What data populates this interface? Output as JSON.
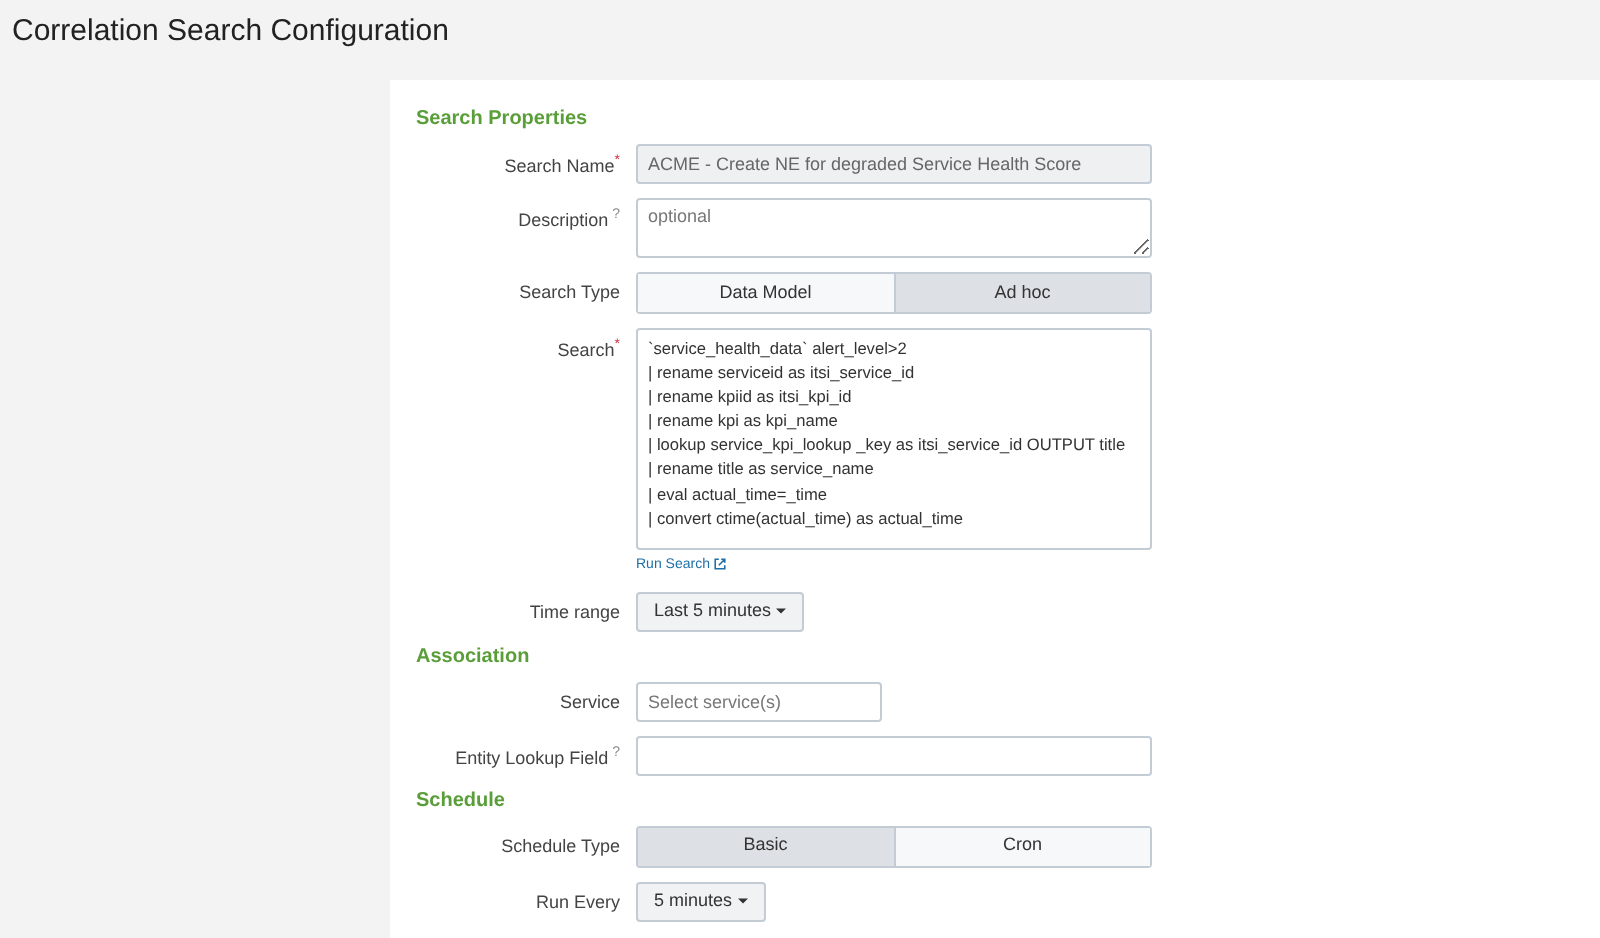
{
  "page_title": "Correlation Search Configuration",
  "sections": [
    {
      "title": "Search Properties",
      "rows": [
        {
          "kind": "text",
          "label": "Search Name",
          "required_mark": "*",
          "value": "ACME - Create NE for degraded Service Health Score",
          "readonly": true
        },
        {
          "kind": "textarea",
          "label": "Description",
          "help_mark": "?",
          "placeholder": "optional"
        },
        {
          "kind": "toggle",
          "label": "Search Type",
          "options": [
            {
              "label": "Data Model",
              "selected": false
            },
            {
              "label": "Ad hoc",
              "selected": true
            }
          ]
        },
        {
          "kind": "code",
          "label": "Search",
          "required_mark": "*",
          "lines": [
            "`service_health_data` alert_level>2",
            "| rename serviceid as itsi_service_id",
            "| rename kpiid as itsi_kpi_id",
            "| rename kpi as kpi_name",
            "| lookup service_kpi_lookup _key as itsi_service_id OUTPUT title",
            "| rename title as service_name",
            "| eval actual_time=_time",
            "| convert ctime(actual_time) as actual_time"
          ],
          "link": "Run Search"
        },
        {
          "kind": "dropdown",
          "label": "Time range",
          "value": "Last 5 minutes"
        }
      ]
    },
    {
      "title": "Association",
      "rows": [
        {
          "kind": "short",
          "label": "Service",
          "placeholder": "Select service(s)"
        },
        {
          "kind": "text",
          "label": "Entity Lookup Field",
          "help_mark": "?"
        }
      ]
    },
    {
      "title": "Schedule",
      "rows": [
        {
          "kind": "toggle",
          "label": "Schedule Type",
          "options": [
            {
              "label": "Basic",
              "selected": true
            },
            {
              "label": "Cron",
              "selected": false
            }
          ]
        },
        {
          "kind": "dropdown",
          "label": "Run Every",
          "value": "5 minutes"
        }
      ]
    }
  ]
}
